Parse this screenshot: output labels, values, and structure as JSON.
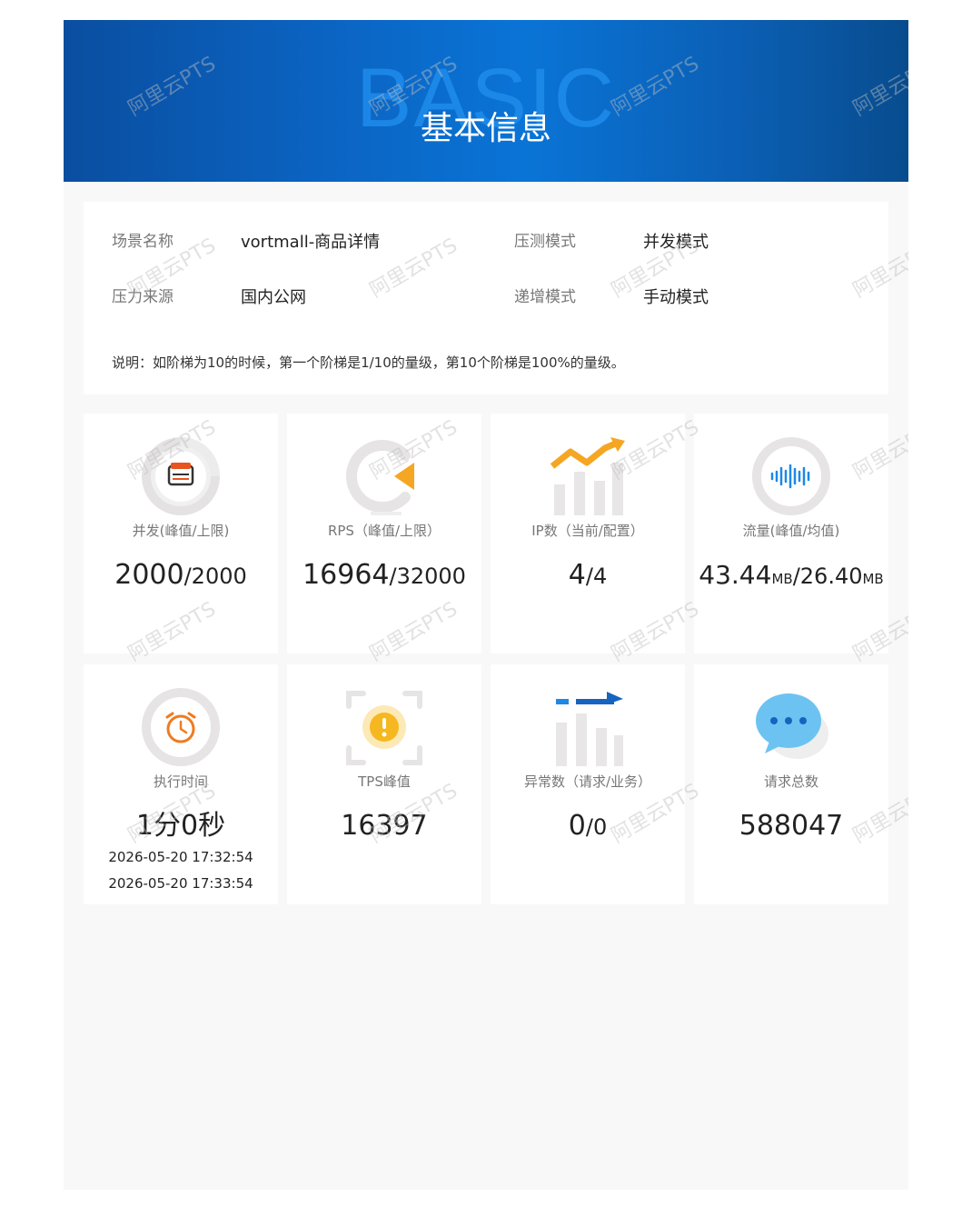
{
  "banner": {
    "bg_word": "BASIC",
    "title": "基本信息"
  },
  "info": {
    "scene_label": "场景名称",
    "scene_value": "vortmall-商品详情",
    "mode_label": "压测模式",
    "mode_value": "并发模式",
    "source_label": "压力来源",
    "source_value": "国内公网",
    "ramp_label": "递增模式",
    "ramp_value": "手动模式",
    "note": "说明：如阶梯为10的时候，第一个阶梯是1/10的量级，第10个阶梯是100%的量级。"
  },
  "stats": {
    "concurrency": {
      "label": "并发(峰值/上限)",
      "peak": "2000",
      "limit": "/2000"
    },
    "rps": {
      "label": "RPS（峰值/上限）",
      "peak": "16964",
      "limit": "/32000"
    },
    "ip": {
      "label": "IP数（当前/配置）",
      "current": "4",
      "config": "/4"
    },
    "traffic": {
      "label": "流量(峰值/均值)",
      "peak": "43.44",
      "peak_unit": "MB",
      "avg": "/26.40",
      "avg_unit": "MB"
    },
    "duration": {
      "label": "执行时间",
      "value": "1分0秒",
      "start": "2026-05-20 17:32:54",
      "end": "2026-05-20 17:33:54"
    },
    "tps": {
      "label": "TPS峰值",
      "value": "16397"
    },
    "errors": {
      "label": "异常数（请求/业务）",
      "request": "0",
      "business": "/0"
    },
    "requests": {
      "label": "请求总数",
      "value": "588047"
    }
  },
  "watermark": {
    "text": "阿里云PTS"
  },
  "colors": {
    "banner_blue": "#0b63c1",
    "accent_orange": "#f5a623",
    "accent_blue": "#1e88e5"
  }
}
